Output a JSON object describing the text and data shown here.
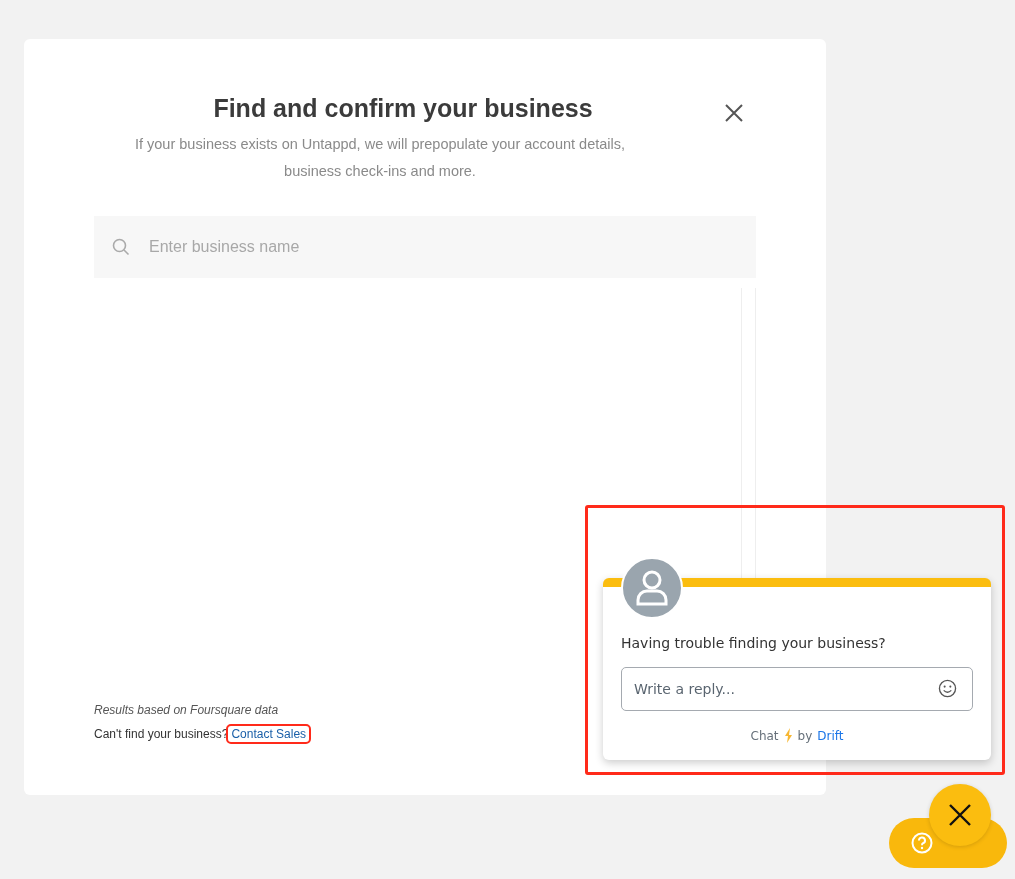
{
  "modal": {
    "title": "Find and confirm your business",
    "subtitle": "If your business exists on Untappd, we will prepopulate your account details, business check-ins and more.",
    "search": {
      "placeholder": "Enter business name"
    },
    "source_note": "Results based on Foursquare data",
    "prompt": "Can't find your business?",
    "link": {
      "label": "Contact Sales",
      "highlighted": true
    }
  },
  "chat": {
    "highlighted": true,
    "message": "Having trouble finding your business?",
    "reply": {
      "placeholder": "Write a reply..."
    },
    "footer": {
      "prefix": "Chat",
      "by": "by",
      "brand": "Drift"
    }
  }
}
